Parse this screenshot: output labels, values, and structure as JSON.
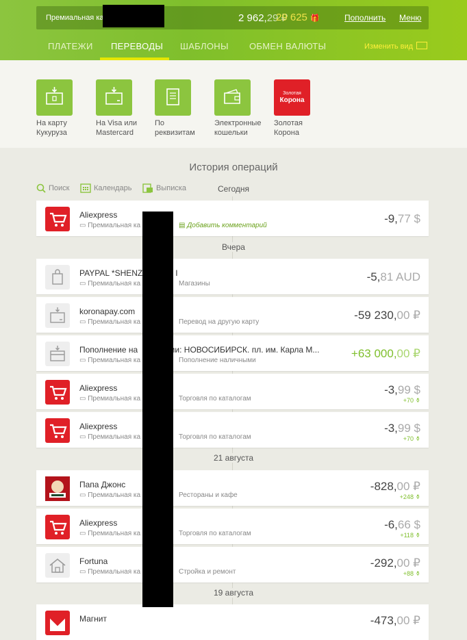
{
  "header": {
    "account_name": "Премиальная ка",
    "balance_main": "2 962,",
    "balance_cents": "29 ₽",
    "bonus": "29 625",
    "bonus_icon": "gift-icon",
    "topup_label": "Пополнить",
    "menu_label": "Меню"
  },
  "tabs": [
    {
      "label": "ПЛАТЕЖИ"
    },
    {
      "label": "ПЕРЕВОДЫ"
    },
    {
      "label": "ШАБЛОНЫ"
    },
    {
      "label": "ОБМЕН ВАЛЮТЫ"
    }
  ],
  "view_toggle": "Изменить вид",
  "quick_actions": [
    {
      "line1": "На карту",
      "line2": "Кукуруза",
      "icon": "card-download-icon"
    },
    {
      "line1": "На Visa или",
      "line2": "Mastercard",
      "icon": "card-download-icon"
    },
    {
      "line1": "По",
      "line2": "реквизитам",
      "icon": "document-icon"
    },
    {
      "line1": "Электронные",
      "line2": "кошельки",
      "icon": "wallet-icon"
    },
    {
      "line1": "Золотая",
      "line2": "Корона",
      "icon": "zolotaya-korona-logo",
      "logo_text1": "Золотая",
      "logo_text2": "Корона"
    }
  ],
  "history": {
    "title": "История операций",
    "tools": {
      "search": "Поиск",
      "calendar": "Календарь",
      "statement": "Выписка"
    },
    "dates": [
      "Сегодня",
      "Вчера",
      "21 августа",
      "19 августа"
    ],
    "transactions": [
      {
        "merchant": "Aliexpress",
        "sub": "Премиальная ка",
        "category": "Добавить комментарий",
        "amount": "-9,",
        "cents": "77 $",
        "bonus": ""
      },
      {
        "merchant": "PAYPAL *SHENZ",
        "merchant_tail": "I",
        "sub": "Премиальная ка",
        "category": "Магазины",
        "amount": "-5,",
        "cents": "81 AUD",
        "bonus": ""
      },
      {
        "merchant": "koronapay.com",
        "sub": "Премиальная ка",
        "category": "Перевод на другую карту",
        "amount": "-59 230,",
        "cents": "00 ₽",
        "bonus": ""
      },
      {
        "merchant": "Пополнение на",
        "merchant_tail": "ми: НОВОСИБИРСК. пл. им. Карла М...",
        "sub": "Премиальная ка",
        "category": "Пополнение наличными",
        "amount": "+63 000,",
        "cents": "00 ₽",
        "bonus": ""
      },
      {
        "merchant": "Aliexpress",
        "sub": "Премиальная ка",
        "category": "Торговля по каталогам",
        "amount": "-3,",
        "cents": "99 $",
        "bonus": "+70 ⚱"
      },
      {
        "merchant": "Aliexpress",
        "sub": "Премиальная ка",
        "category": "Торговля по каталогам",
        "amount": "-3,",
        "cents": "99 $",
        "bonus": "+70 ⚱"
      },
      {
        "merchant": "Папа Джонс",
        "sub": "Премиальная ка",
        "category": "Рестораны и кафе",
        "amount": "-828,",
        "cents": "00 ₽",
        "bonus": "+248 ⚱"
      },
      {
        "merchant": "Aliexpress",
        "sub": "Премиальная ка",
        "category": "Торговля по каталогам",
        "amount": "-6,",
        "cents": "66 $",
        "bonus": "+118 ⚱"
      },
      {
        "merchant": "Fortuna",
        "sub": "Премиальная ка",
        "category": "Стройка и ремонт",
        "amount": "-292,",
        "cents": "00 ₽",
        "bonus": "+88 ⚱"
      },
      {
        "merchant": "Магнит",
        "sub": "",
        "category": "",
        "amount": "-473,",
        "cents": "00 ₽",
        "bonus": ""
      }
    ]
  },
  "colors": {
    "brand_green": "#8cc53f",
    "accent_yellow": "#e6e600",
    "alert_red": "#e02027"
  }
}
